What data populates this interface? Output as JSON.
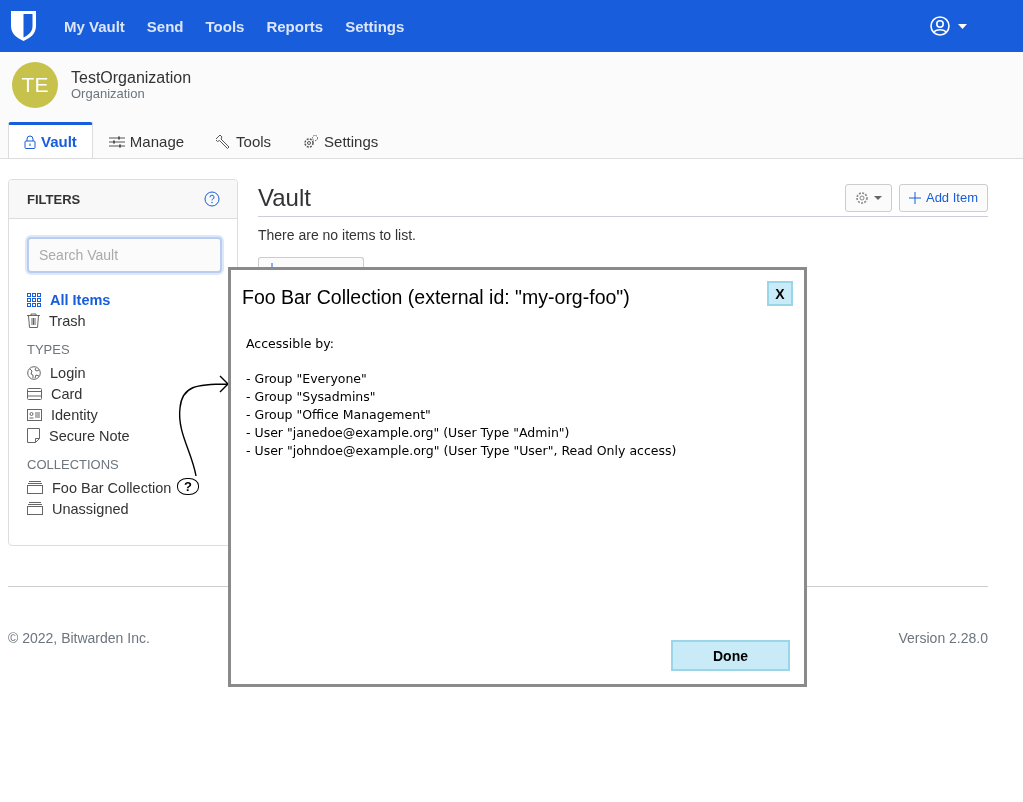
{
  "navbar": {
    "links": [
      {
        "label": "My Vault"
      },
      {
        "label": "Send"
      },
      {
        "label": "Tools"
      },
      {
        "label": "Reports"
      },
      {
        "label": "Settings"
      }
    ]
  },
  "organization": {
    "initials": "TE",
    "name": "TestOrganization",
    "type": "Organization"
  },
  "tabs": [
    {
      "label": "Vault",
      "selected": true
    },
    {
      "label": "Manage",
      "selected": false
    },
    {
      "label": "Tools",
      "selected": false
    },
    {
      "label": "Settings",
      "selected": false
    }
  ],
  "filters": {
    "title": "FILTERS",
    "search": {
      "placeholder": "Search Vault"
    },
    "items": [
      {
        "label": "All Items",
        "selected": true
      },
      {
        "label": "Trash",
        "selected": false
      }
    ],
    "types_heading": "TYPES",
    "types": [
      {
        "label": "Login",
        "selected": false
      },
      {
        "label": "Card",
        "selected": false
      },
      {
        "label": "Identity",
        "selected": false
      },
      {
        "label": "Secure Note",
        "selected": false
      }
    ],
    "collections_heading": "COLLECTIONS",
    "collections": [
      {
        "label": "Foo Bar Collection",
        "selected": false
      },
      {
        "label": "Unassigned",
        "selected": false
      }
    ]
  },
  "vault": {
    "title": "Vault",
    "add_item": "Add Item",
    "empty_message": "There are no items to list."
  },
  "annotation": {
    "mark": "?"
  },
  "dialog": {
    "title": "Foo Bar Collection (external id: \"my-org-foo\")",
    "close": "X",
    "intro": "Accessible by:",
    "lines": [
      "- Group \"Everyone\"",
      "- Group \"Sysadmins\"",
      "- Group \"Office Management\"",
      "- User \"janedoe@example.org\" (User Type \"Admin\")",
      "- User \"johndoe@example.org\" (User Type \"User\", Read Only access)"
    ],
    "done": "Done"
  },
  "footer": {
    "copyright": "© 2022, Bitwarden Inc.",
    "version": "Version 2.28.0"
  }
}
